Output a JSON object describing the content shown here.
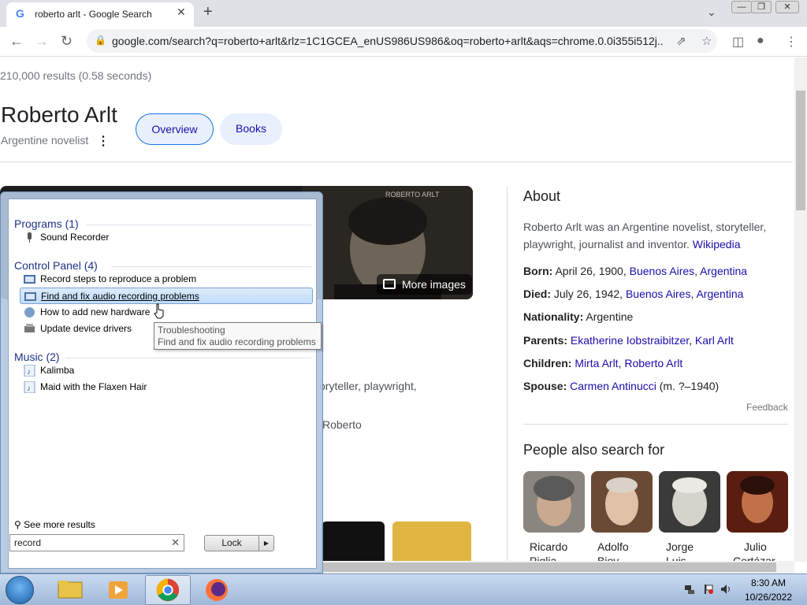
{
  "browser": {
    "tab_title": "roberto arlt - Google Search",
    "new_tab": "+",
    "tab_close": "✕",
    "url": "google.com/search?q=roberto+arlt&rlz=1C1GCEA_enUS986US986&oq=roberto+arlt&aqs=chrome.0.0i355i512j..."
  },
  "search": {
    "result_stats": "210,000 results (0.58 seconds)"
  },
  "knowledge_panel": {
    "title": "Roberto Arlt",
    "subtitle": "Argentine novelist",
    "chips": [
      "Overview",
      "Books"
    ],
    "more_images": "More images",
    "desc_fragment_1": "oryteller, playwright,",
    "desc_fragment_2": "Roberto",
    "about_heading": "About",
    "about_text": "Roberto Arlt was an Argentine novelist, storyteller, playwright, journalist and inventor.",
    "about_source": "Wikipedia",
    "facts": {
      "born_label": "Born:",
      "born_value": "April 26, 1900,",
      "born_place1": "Buenos Aires",
      "born_place2": "Argentina",
      "died_label": "Died:",
      "died_value": "July 26, 1942,",
      "died_place1": "Buenos Aires",
      "died_place2": "Argentina",
      "nationality_label": "Nationality:",
      "nationality_value": "Argentine",
      "parents_label": "Parents:",
      "parent1": "Ekatherine Iobstraibitzer",
      "parent2": "Karl Arlt",
      "children_label": "Children:",
      "child1": "Mirta Arlt",
      "child2": "Roberto Arlt",
      "spouse_label": "Spouse:",
      "spouse": "Carmen Antinucci",
      "spouse_dates": "(m. ?–1940)"
    },
    "feedback": "Feedback",
    "people_heading": "People also search for",
    "people": [
      {
        "first": "Ricardo",
        "second": "Piglia"
      },
      {
        "first": "Adolfo",
        "second": "Bioy"
      },
      {
        "first": "Jorge",
        "second": "Luis"
      },
      {
        "first": "Julio",
        "second": "Cortázar"
      }
    ]
  },
  "start_menu": {
    "categories": {
      "programs": "Programs (1)",
      "control_panel": "Control Panel (4)",
      "music": "Music (2)"
    },
    "programs": [
      "Sound Recorder"
    ],
    "control_panel": [
      "Record steps to reproduce a problem",
      "Find and fix audio recording problems",
      "How to add new hardware",
      "Update device drivers"
    ],
    "music": [
      "Kalimba",
      "Maid with the Flaxen Hair"
    ],
    "tooltip_title": "Troubleshooting",
    "tooltip_body": "Find and fix audio recording problems",
    "see_more": "See more results",
    "search_value": "record",
    "lock_label": "Lock"
  },
  "taskbar": {
    "time": "8:30 AM",
    "date": "10/26/2022"
  },
  "colors": {
    "link": "#1a0dab",
    "chip_bg": "#e8f0fe",
    "start_menu_category": "#1e3287",
    "taskbar": "#b4c9e6"
  }
}
